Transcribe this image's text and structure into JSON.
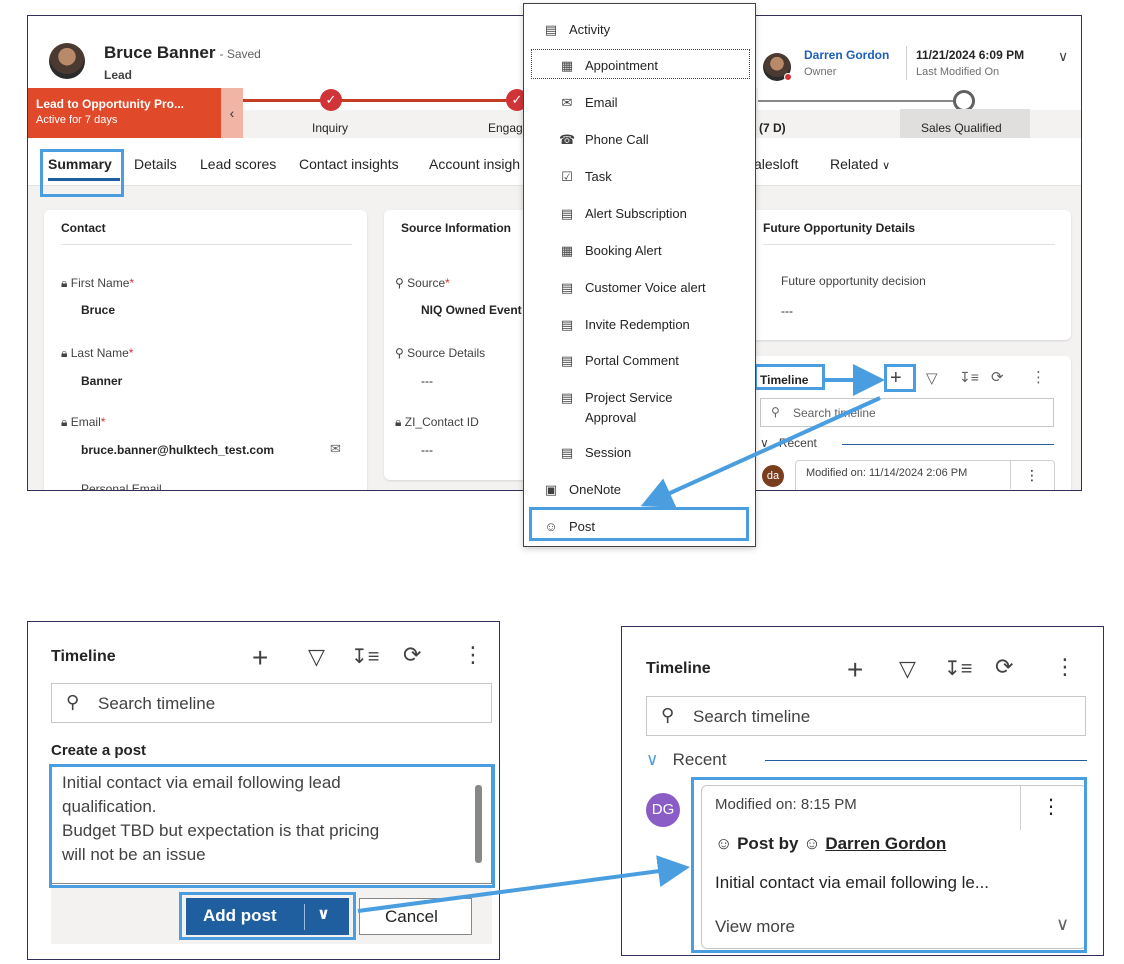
{
  "record": {
    "name": "Bruce Banner",
    "saved": "- Saved",
    "type": "Lead",
    "owner_name": "Darren Gordon",
    "owner_label": "Owner",
    "modified_value": "11/21/2024 6:09 PM",
    "modified_label": "Last Modified On"
  },
  "bpf": {
    "title": "Lead to Opportunity Pro...",
    "active": "Active for 7 days",
    "stages": [
      "Inquiry",
      "Engag",
      "(7 D)",
      "Sales Qualified"
    ]
  },
  "tabs": [
    "Summary",
    "Details",
    "Lead scores",
    "Contact insights",
    "Account insigh",
    "alesloft",
    "Related"
  ],
  "contact": {
    "title": "Contact",
    "first_name_label": "First Name",
    "first_name": "Bruce",
    "last_name_label": "Last Name",
    "last_name": "Banner",
    "email_label": "Email",
    "email": "bruce.banner@hulktech_test.com",
    "personal_email_label": "Personal Email"
  },
  "source": {
    "title": "Source Information",
    "source_label": "Source",
    "source_value": "NIQ Owned Event",
    "details_label": "Source Details",
    "details_value": "---",
    "zi_label": "ZI_Contact ID",
    "zi_value": "---"
  },
  "future": {
    "title": "Future Opportunity Details",
    "decision_label": "Future opportunity decision",
    "decision_value": "---"
  },
  "timeline_small": {
    "title": "Timeline",
    "search": "Search timeline",
    "recent": "Recent",
    "avatar": "da",
    "modified": "Modified on: 11/14/2024 2:06 PM"
  },
  "menu": {
    "items": [
      {
        "label": "Activity",
        "icon": "activity-icon"
      },
      {
        "label": "Appointment",
        "icon": "calendar-icon"
      },
      {
        "label": "Email",
        "icon": "mail-icon"
      },
      {
        "label": "Phone Call",
        "icon": "phone-icon"
      },
      {
        "label": "Task",
        "icon": "task-icon"
      },
      {
        "label": "Alert Subscription",
        "icon": "activity-icon"
      },
      {
        "label": "Booking Alert",
        "icon": "calendar-icon"
      },
      {
        "label": "Customer Voice alert",
        "icon": "activity-icon"
      },
      {
        "label": "Invite Redemption",
        "icon": "activity-icon"
      },
      {
        "label": "Portal Comment",
        "icon": "activity-icon"
      },
      {
        "label": "Project Service Approval",
        "icon": "activity-icon"
      },
      {
        "label": "Session",
        "icon": "activity-icon"
      },
      {
        "label": "OneNote",
        "icon": "onenote-icon"
      },
      {
        "label": "Post",
        "icon": "post-icon"
      }
    ]
  },
  "create_post": {
    "title": "Timeline",
    "search": "Search timeline",
    "heading": "Create a post",
    "text": "Initial contact via email following lead\nqualification.\nBudget TBD but expectation is that pricing\nwill not be an issue",
    "add_button": "Add post",
    "cancel_button": "Cancel"
  },
  "result": {
    "title": "Timeline",
    "search": "Search timeline",
    "recent": "Recent",
    "avatar": "DG",
    "modified": "Modified on: 8:15 PM",
    "post_by": "Post by",
    "author": "Darren Gordon",
    "snippet": "Initial contact via email following le...",
    "view_more": "View more"
  },
  "colors": {
    "accent": "#4a9ee0",
    "bpf_active": "#e04a2b",
    "primary_button": "#1f5f9f",
    "avatar_dg": "#8a5cc6",
    "avatar_da": "#7a3e1f"
  }
}
